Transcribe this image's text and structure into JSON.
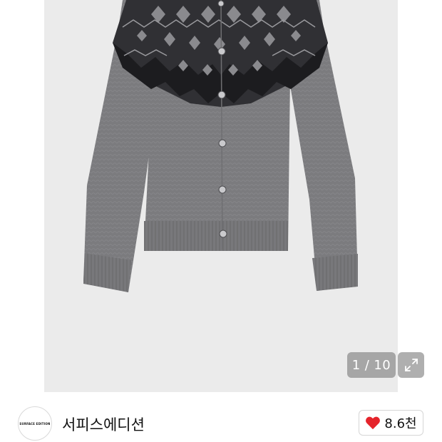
{
  "gallery": {
    "current": "1",
    "separator": "/",
    "total": "10",
    "expand_icon": "expand-arrows-icon"
  },
  "store": {
    "logo_text": "SURFACE EDITION",
    "name": "서피스에디션"
  },
  "like": {
    "icon": "heart-icon",
    "count": "8.6천",
    "color": "#e5242b"
  },
  "colors": {
    "photo_background": "#ebebeb",
    "sweater_gray": "#7b7b7e",
    "pattern_dark": "#1f1f22"
  }
}
